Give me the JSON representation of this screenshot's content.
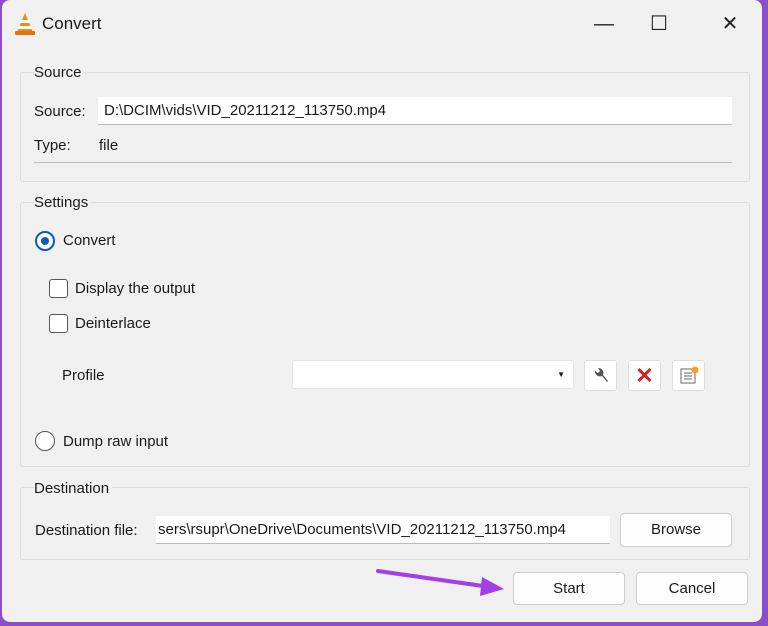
{
  "window": {
    "title": "Convert",
    "minimize": "—",
    "maximize": "☐",
    "close": "✕"
  },
  "source": {
    "group_label": "Source",
    "source_label": "Source:",
    "source_value": "D:\\DCIM\\vids\\VID_20211212_113750.mp4",
    "type_label": "Type:",
    "type_value": "file"
  },
  "settings": {
    "group_label": "Settings",
    "convert_label": "Convert",
    "convert_selected": true,
    "display_output_label": "Display the output",
    "display_output_checked": false,
    "deinterlace_label": "Deinterlace",
    "deinterlace_checked": false,
    "profile_label": "Profile",
    "profile_value": "",
    "dump_raw_label": "Dump raw input",
    "dump_raw_selected": false
  },
  "destination": {
    "group_label": "Destination",
    "file_label": "Destination file:",
    "file_value": "sers\\rsupr\\OneDrive\\Documents\\VID_20211212_113750.mp4",
    "browse": "Browse"
  },
  "buttons": {
    "start": "Start",
    "cancel": "Cancel"
  },
  "colors": {
    "accent": "#0a5cb8",
    "annotation_arrow": "#a040e8"
  }
}
